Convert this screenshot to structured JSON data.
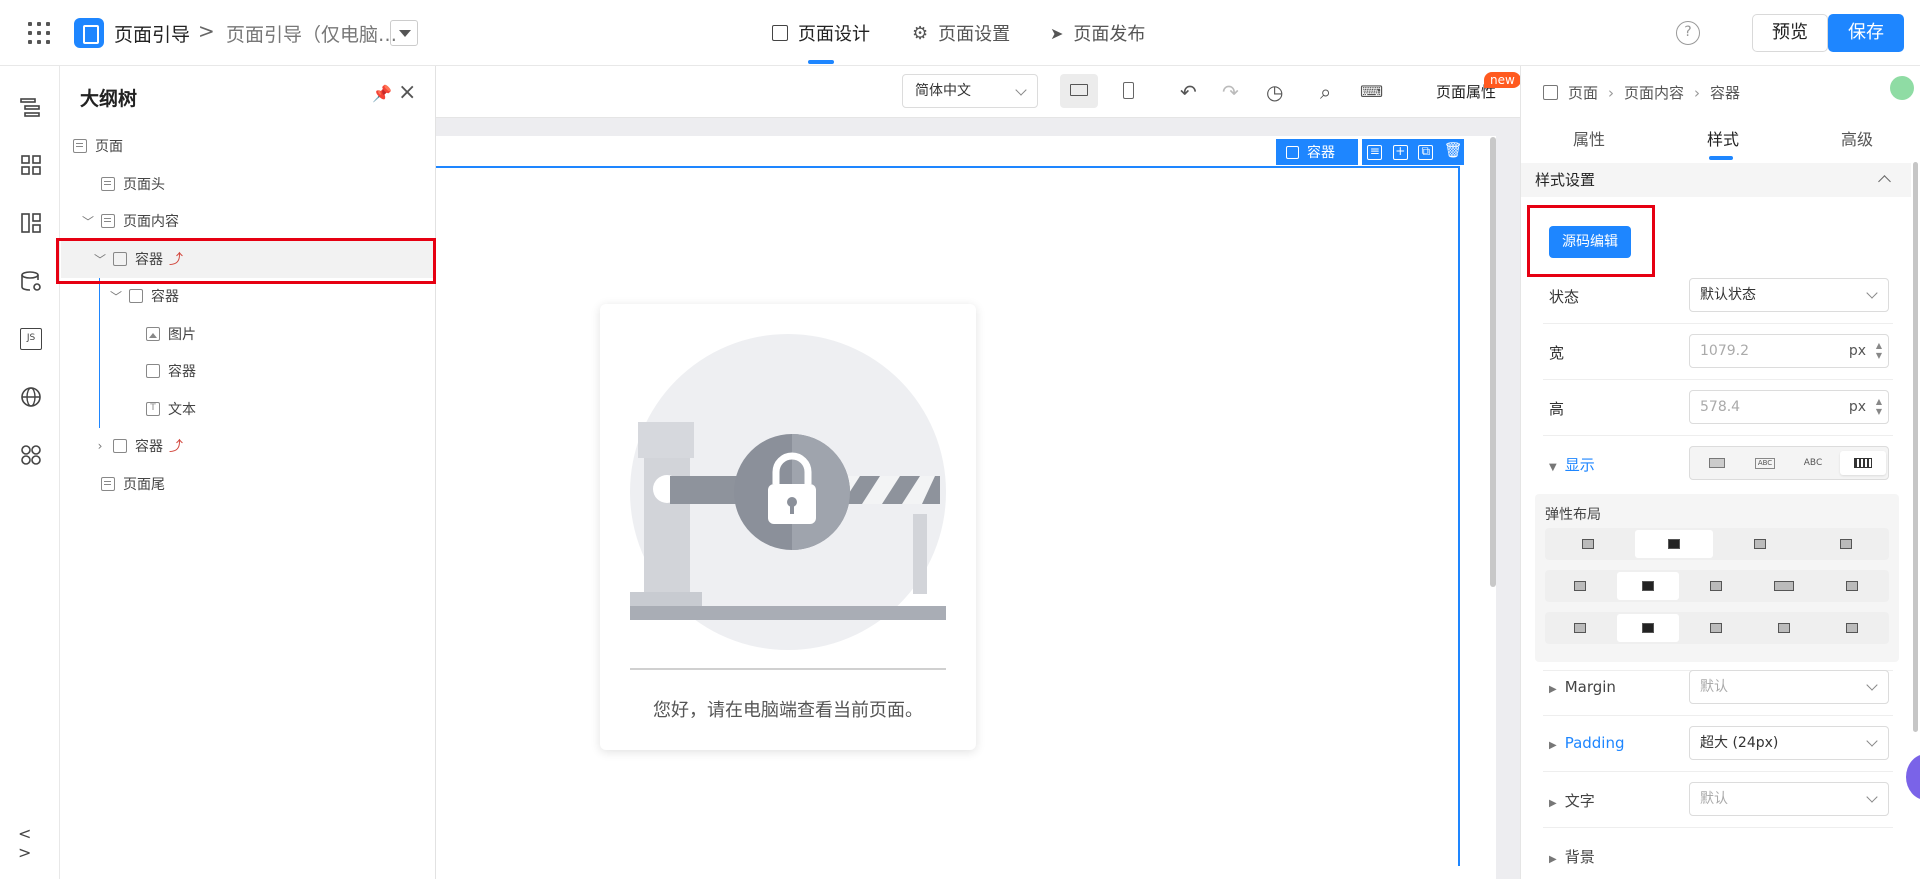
{
  "header": {
    "app_title": "页面引导",
    "breadcrumb_sep": ">",
    "page_name": "页面引导（仅电脑…",
    "tabs": [
      {
        "label": "页面设计"
      },
      {
        "label": "页面设置"
      },
      {
        "label": "页面发布"
      }
    ],
    "help_label": "?",
    "preview_label": "预览",
    "save_label": "保存"
  },
  "icon_bar": {
    "items": [
      "outline-icon",
      "components-icon",
      "layout-icon",
      "datasource-icon",
      "js-icon",
      "globe-icon",
      "apps-icon",
      "code-icon"
    ],
    "js_text": "JS",
    "code_text": "< >"
  },
  "outline": {
    "title": "大纲树",
    "nodes": [
      {
        "label": "页面"
      },
      {
        "label": "页面头"
      },
      {
        "label": "页面内容"
      },
      {
        "label": "容器"
      },
      {
        "label": "容器"
      },
      {
        "label": "图片"
      },
      {
        "label": "容器"
      },
      {
        "label": "文本"
      },
      {
        "label": "容器"
      },
      {
        "label": "页面尾"
      }
    ]
  },
  "canvas_toolbar": {
    "language": "简体中文",
    "page_props_label": "页面属性",
    "new_badge": "new"
  },
  "canvas": {
    "container_tag": "容器",
    "hint_text": "您好，请在电脑端查看当前页面。"
  },
  "props": {
    "breadcrumb": [
      "页面",
      "页面内容",
      "容器"
    ],
    "tabs": [
      "属性",
      "样式",
      "高级"
    ],
    "section_title": "样式设置",
    "source_edit_label": "源码编辑",
    "state_label": "状态",
    "state_value": "默认状态",
    "width_label": "宽",
    "width_value": "1079.2",
    "height_label": "高",
    "height_value": "578.4",
    "unit": "px",
    "display_label": "显示",
    "display_options": [
      "",
      "ABC",
      "ABC",
      ""
    ],
    "flex_label": "弹性布局",
    "margin_label": "Margin",
    "margin_value": "默认",
    "padding_label": "Padding",
    "padding_value": "超大 (24px)",
    "text_label": "文字",
    "text_value": "默认",
    "bg_label": "背景"
  },
  "colors": {
    "accent": "#1e86ff",
    "highlight": "#e60012"
  }
}
